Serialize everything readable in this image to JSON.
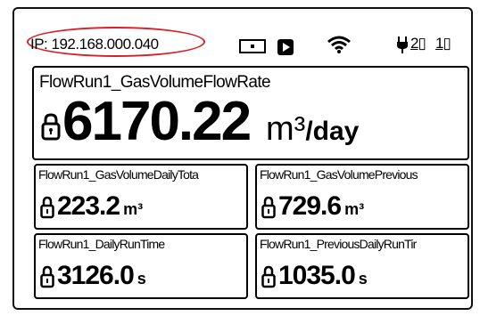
{
  "status": {
    "ip_text": "IP: 192.168.000.040",
    "icons": [
      "card-icon",
      "sd-card-icon",
      "wifi-icon",
      "plug-icon"
    ],
    "port2": "2",
    "port1": "1",
    "highlight_color": "#d81f26"
  },
  "main": {
    "title": "FlowRun1_GasVolumeFlowRate",
    "value": "6170.22",
    "unit_base": "m³",
    "unit_slash": "/day"
  },
  "cells": [
    {
      "title": "FlowRun1_GasVolumeDailyTota",
      "value": "223.2",
      "unit": "m³"
    },
    {
      "title": "FlowRun1_GasVolumePrevious",
      "value": "729.6",
      "unit": "m³"
    },
    {
      "title": "FlowRun1_DailyRunTime",
      "value": "3126.0",
      "unit": "s"
    },
    {
      "title": "FlowRun1_PreviousDailyRunTir",
      "value": "1035.0",
      "unit": "s"
    }
  ]
}
